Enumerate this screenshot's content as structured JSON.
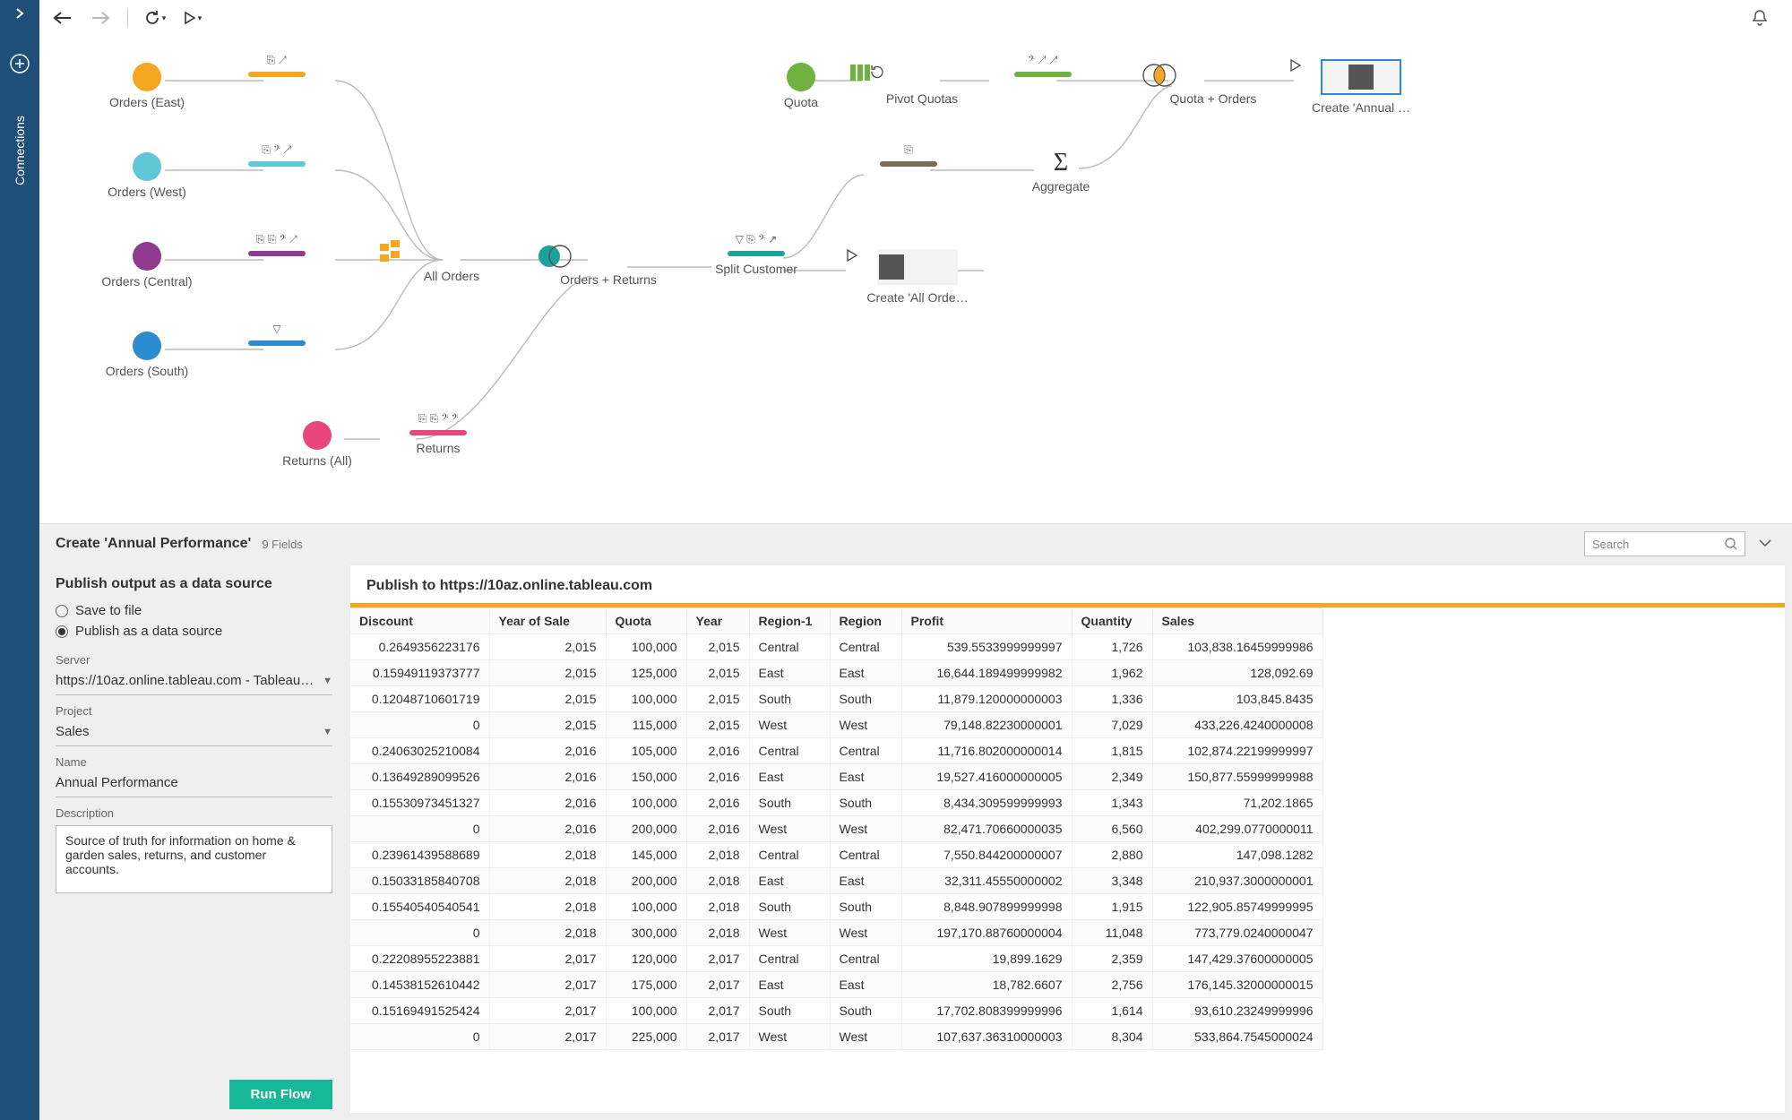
{
  "sidebar": {
    "label": "Connections"
  },
  "toolbar": {
    "back": "←",
    "forward": "→",
    "refresh": "⟳",
    "run": "▷"
  },
  "flow": {
    "nodes": {
      "orders_east": {
        "label": "Orders (East)",
        "icons": "⎘ ↗"
      },
      "orders_west": {
        "label": "Orders (West)",
        "icons": "⎘ 𝄢 ↗"
      },
      "orders_central": {
        "label": "Orders (Central)",
        "icons": "⎘ ⎘ 𝄢 ↗"
      },
      "orders_south": {
        "label": "Orders (South)",
        "icons": "▽"
      },
      "returns_all": {
        "label": "Returns (All)",
        "icons": ""
      },
      "returns": {
        "label": "Returns",
        "icons": "⎘ ⎘ 𝄢 𝄢"
      },
      "all_orders": {
        "label": "All Orders",
        "icons": ""
      },
      "orders_returns": {
        "label": "Orders + Returns",
        "icons": ""
      },
      "split_customer": {
        "label": "Split Customer",
        "icons": "▽ ⎘ 𝄢 ↗"
      },
      "quota": {
        "label": "Quota",
        "icons": ""
      },
      "pivot_quotas": {
        "label": "Pivot Quotas",
        "icons": ""
      },
      "clean_quotas": {
        "label": "",
        "icons": "𝄢 ↗ ↗"
      },
      "clean_split": {
        "label": "",
        "icons": "⎘"
      },
      "create_all": {
        "label": "Create 'All Orde…",
        "icons": ""
      },
      "aggregate": {
        "label": "Aggregate",
        "icons": ""
      },
      "quota_orders": {
        "label": "Quota + Orders",
        "icons": ""
      },
      "create_annual": {
        "label": "Create 'Annual …",
        "icons": ""
      }
    }
  },
  "bottom": {
    "title": "Create 'Annual Performance'",
    "field_count": "9 Fields",
    "search_placeholder": "Search",
    "config": {
      "heading": "Publish output as a data source",
      "save_to_file": "Save to file",
      "publish_as": "Publish as a data source",
      "server_label": "Server",
      "server_value": "https://10az.online.tableau.com - Tableau…",
      "project_label": "Project",
      "project_value": "Sales",
      "name_label": "Name",
      "name_value": "Annual Performance",
      "desc_label": "Description",
      "desc_value": "Source of truth for information on home & garden sales, returns, and customer accounts.",
      "run_button": "Run Flow"
    },
    "preview": {
      "title": "Publish to https://10az.online.tableau.com",
      "columns": [
        "Discount",
        "Year of Sale",
        "Quota",
        "Year",
        "Region-1",
        "Region",
        "Profit",
        "Quantity",
        "Sales"
      ],
      "rows": [
        [
          "0.2649356223176",
          "2,015",
          "100,000",
          "2,015",
          "Central",
          "Central",
          "539.5533999999997",
          "1,726",
          "103,838.16459999986"
        ],
        [
          "0.15949119373777",
          "2,015",
          "125,000",
          "2,015",
          "East",
          "East",
          "16,644.189499999982",
          "1,962",
          "128,092.69"
        ],
        [
          "0.12048710601719",
          "2,015",
          "100,000",
          "2,015",
          "South",
          "South",
          "11,879.120000000003",
          "1,336",
          "103,845.8435"
        ],
        [
          "0",
          "2,015",
          "115,000",
          "2,015",
          "West",
          "West",
          "79,148.82230000001",
          "7,029",
          "433,226.4240000008"
        ],
        [
          "0.24063025210084",
          "2,016",
          "105,000",
          "2,016",
          "Central",
          "Central",
          "11,716.802000000014",
          "1,815",
          "102,874.22199999997"
        ],
        [
          "0.13649289099526",
          "2,016",
          "150,000",
          "2,016",
          "East",
          "East",
          "19,527.416000000005",
          "2,349",
          "150,877.55999999988"
        ],
        [
          "0.15530973451327",
          "2,016",
          "100,000",
          "2,016",
          "South",
          "South",
          "8,434.309599999993",
          "1,343",
          "71,202.1865"
        ],
        [
          "0",
          "2,016",
          "200,000",
          "2,016",
          "West",
          "West",
          "82,471.70660000035",
          "6,560",
          "402,299.0770000011"
        ],
        [
          "0.23961439588689",
          "2,018",
          "145,000",
          "2,018",
          "Central",
          "Central",
          "7,550.844200000007",
          "2,880",
          "147,098.1282"
        ],
        [
          "0.15033185840708",
          "2,018",
          "200,000",
          "2,018",
          "East",
          "East",
          "32,311.45550000002",
          "3,348",
          "210,937.3000000001"
        ],
        [
          "0.15540540540541",
          "2,018",
          "100,000",
          "2,018",
          "South",
          "South",
          "8,848.907899999998",
          "1,915",
          "122,905.85749999995"
        ],
        [
          "0",
          "2,018",
          "300,000",
          "2,018",
          "West",
          "West",
          "197,170.88760000004",
          "11,048",
          "773,779.0240000047"
        ],
        [
          "0.22208955223881",
          "2,017",
          "120,000",
          "2,017",
          "Central",
          "Central",
          "19,899.1629",
          "2,359",
          "147,429.37600000005"
        ],
        [
          "0.14538152610442",
          "2,017",
          "175,000",
          "2,017",
          "East",
          "East",
          "18,782.6607",
          "2,756",
          "176,145.32000000015"
        ],
        [
          "0.15169491525424",
          "2,017",
          "100,000",
          "2,017",
          "South",
          "South",
          "17,702.808399999996",
          "1,614",
          "93,610.23249999996"
        ],
        [
          "0",
          "2,017",
          "225,000",
          "2,017",
          "West",
          "West",
          "107,637.36310000003",
          "8,304",
          "533,864.7545000024"
        ]
      ]
    }
  }
}
